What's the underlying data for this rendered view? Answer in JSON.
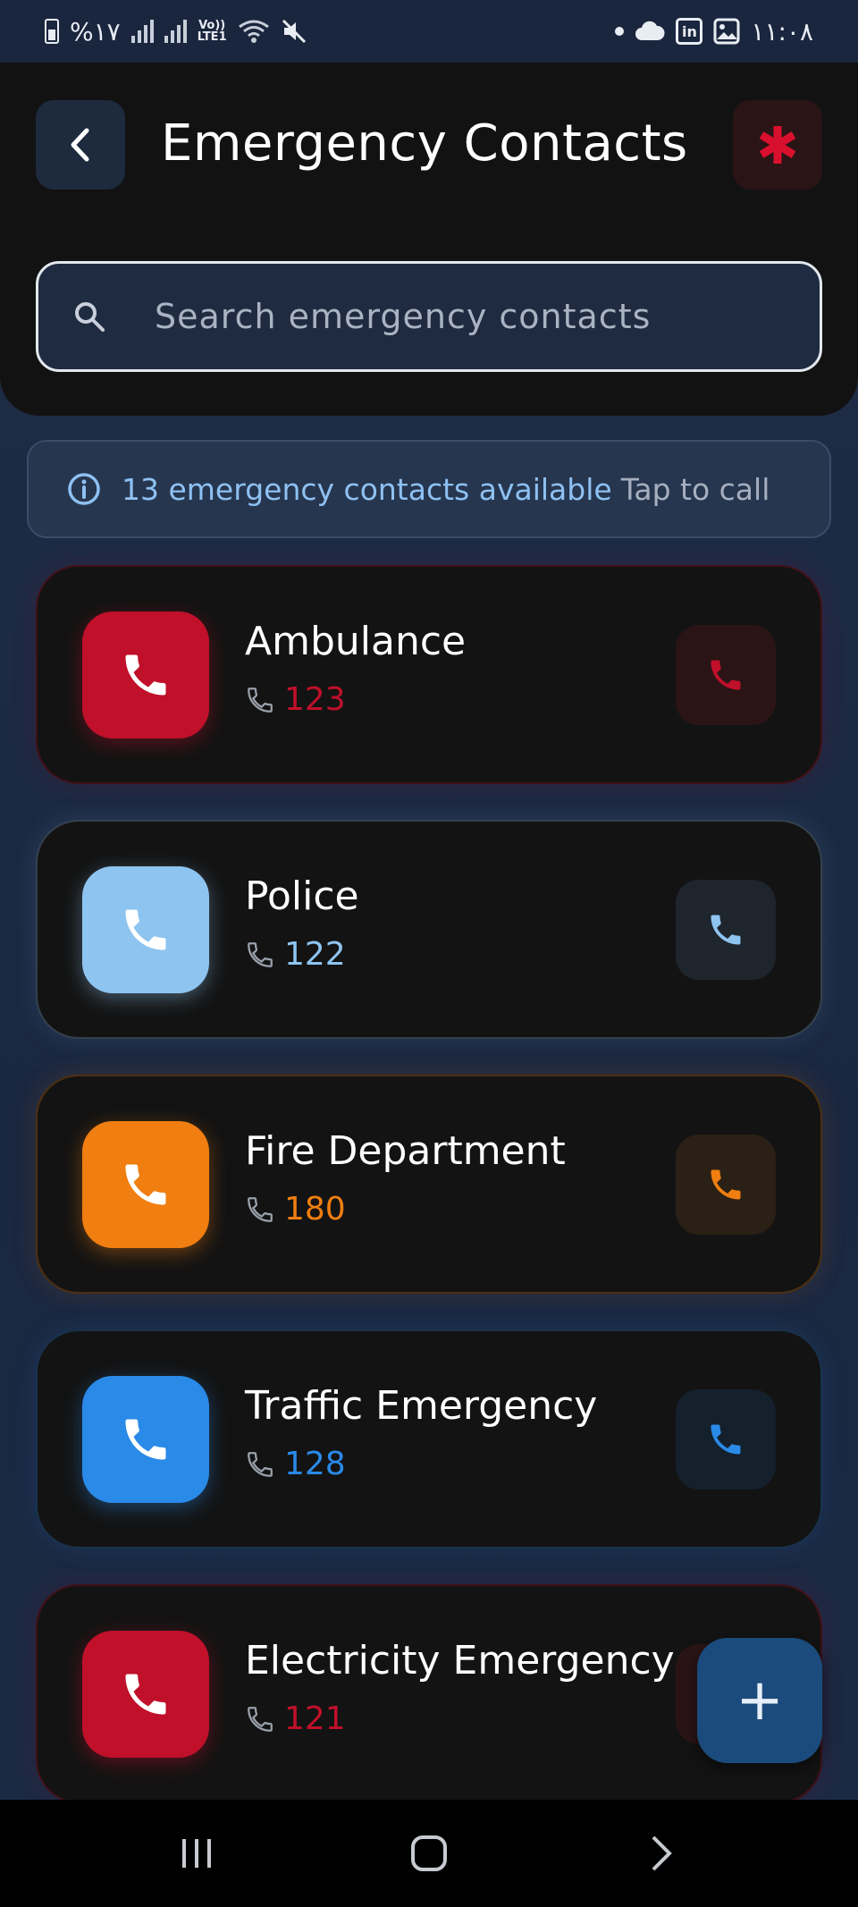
{
  "status_bar": {
    "battery_text": "%۱۷",
    "network_label_top": "Vo))",
    "network_label_bottom": "LTE1",
    "time": "۱۱:۰۸"
  },
  "header": {
    "title": "Emergency Contacts",
    "search_placeholder": "Search emergency contacts"
  },
  "info": {
    "count_text": "13 emergency contacts available",
    "hint_text": "Tap to call"
  },
  "contacts": [
    {
      "name": "Ambulance",
      "number": "123",
      "color": "#c0102a",
      "soft_bg": "#2a1416"
    },
    {
      "name": "Police",
      "number": "122",
      "color": "#8ec4f0",
      "soft_bg": "#1f252d"
    },
    {
      "name": "Fire Department",
      "number": "180",
      "color": "#f07e10",
      "soft_bg": "#2a2015"
    },
    {
      "name": "Traffic Emergency",
      "number": "128",
      "color": "#2a8ae8",
      "soft_bg": "#14202c"
    },
    {
      "name": "Electricity Emergency",
      "number": "121",
      "color": "#c0102a",
      "soft_bg": "#2a1416"
    }
  ],
  "fab": {
    "label": "+"
  },
  "colors": {
    "accent_red": "#c0102a",
    "accent_blue": "#2a8ae8",
    "background": "#1c2a42",
    "card": "#131313"
  }
}
